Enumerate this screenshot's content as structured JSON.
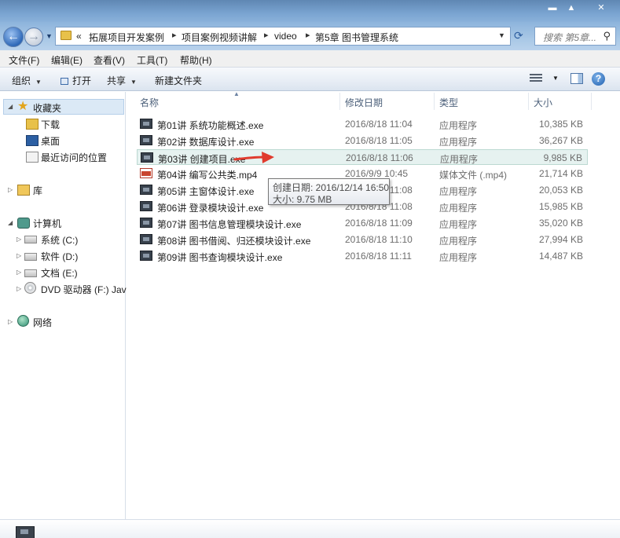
{
  "window": {
    "min_label": "▬",
    "max_label": "▲",
    "close_label": "✕"
  },
  "address": {
    "prefix": "«",
    "crumbs": [
      "拓展项目开发案例",
      "项目案例视频讲解",
      "video",
      "第5章  图书管理系统"
    ],
    "separator": "▸"
  },
  "search": {
    "placeholder": "搜索 第5章..."
  },
  "menu": [
    "文件(F)",
    "编辑(E)",
    "查看(V)",
    "工具(T)",
    "帮助(H)"
  ],
  "toolbar": {
    "organize": "组织",
    "open": "打开",
    "share": "共享",
    "new_folder": "新建文件夹"
  },
  "nav": {
    "favorites": "收藏夹",
    "downloads": "下载",
    "desktop": "桌面",
    "recent": "最近访问的位置",
    "libraries": "库",
    "computer": "计算机",
    "drive_c": "系统 (C:)",
    "drive_d": "软件 (D:)",
    "drive_e": "文档 (E:)",
    "drive_f": "DVD 驱动器 (F:) Java",
    "network": "网络"
  },
  "columns": {
    "name": "名称",
    "date": "修改日期",
    "type": "类型",
    "size": "大小"
  },
  "files": [
    {
      "name": "第01讲 系统功能概述.exe",
      "date": "2016/8/18 11:04",
      "type": "应用程序",
      "size": "10,385 KB",
      "icon": "video-exe-icon"
    },
    {
      "name": "第02讲 数据库设计.exe",
      "date": "2016/8/18 11:05",
      "type": "应用程序",
      "size": "36,267 KB",
      "icon": "video-exe-icon"
    },
    {
      "name": "第03讲 创建项目.exe",
      "date": "2016/8/18 11:06",
      "type": "应用程序",
      "size": "9,985 KB",
      "icon": "video-exe-icon"
    },
    {
      "name": "第04讲 编写公共类.mp4",
      "date": "2016/9/9 10:45",
      "type": "媒体文件 (.mp4)",
      "size": "21,714 KB",
      "icon": "mp4-icon"
    },
    {
      "name": "第05讲 主窗体设计.exe",
      "date": "2016/8/18 11:08",
      "type": "应用程序",
      "size": "20,053 KB",
      "icon": "video-exe-icon"
    },
    {
      "name": "第06讲 登录模块设计.exe",
      "date": "2016/8/18 11:08",
      "type": "应用程序",
      "size": "15,985 KB",
      "icon": "video-exe-icon"
    },
    {
      "name": "第07讲 图书信息管理模块设计.exe",
      "date": "2016/8/18 11:09",
      "type": "应用程序",
      "size": "35,020 KB",
      "icon": "video-exe-icon"
    },
    {
      "name": "第08讲 图书借阅、归还模块设计.exe",
      "date": "2016/8/18 11:10",
      "type": "应用程序",
      "size": "27,994 KB",
      "icon": "video-exe-icon"
    },
    {
      "name": "第09讲 图书查询模块设计.exe",
      "date": "2016/8/18 11:11",
      "type": "应用程序",
      "size": "14,487 KB",
      "icon": "video-exe-icon"
    }
  ],
  "tooltip": {
    "line1": "创建日期: 2016/12/14 16:50",
    "line2": "大小: 9.75 MB"
  },
  "colors": {
    "annotation_arrow": "#e03b2e",
    "hover_row": "#e6f2f0"
  }
}
